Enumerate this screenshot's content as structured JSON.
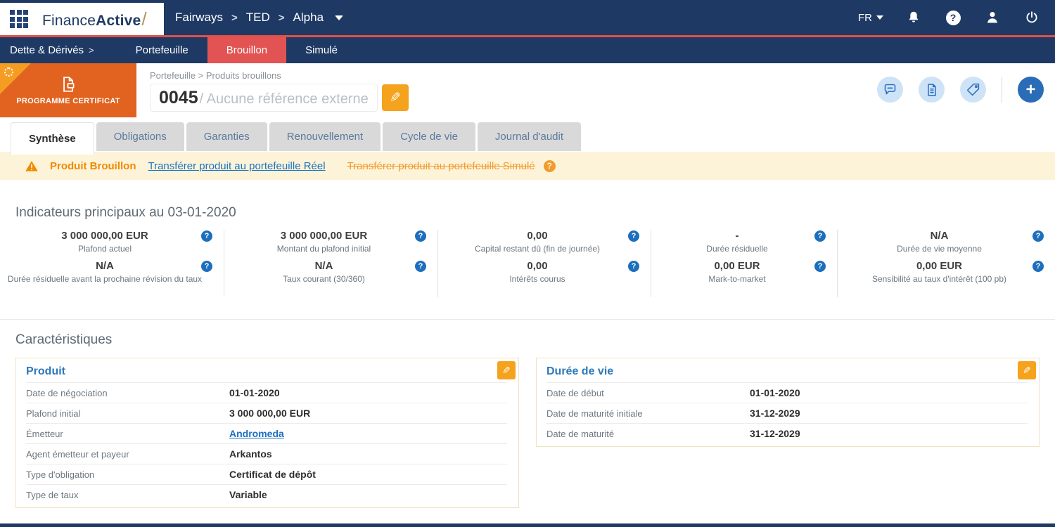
{
  "topbar": {
    "brand_regular": "Finance",
    "brand_bold": "Active",
    "breadcrumb": [
      "Fairways",
      "TED",
      "Alpha"
    ],
    "separator": ">",
    "lang": "FR"
  },
  "subnav": {
    "section": "Dette & Dérivés",
    "section_arrow": ">",
    "items": [
      "Portefeuille",
      "Brouillon",
      "Simulé"
    ]
  },
  "header": {
    "badge": "PROGRAMME CERTIFICAT",
    "breadcrumb": "Portefeuille > Produits brouillons",
    "product_id": "0045",
    "reference": "/ Aucune référence externe"
  },
  "tabs": [
    "Synthèse",
    "Obligations",
    "Garanties",
    "Renouvellement",
    "Cycle de vie",
    "Journal d'audit"
  ],
  "warning": {
    "label": "Produit Brouillon",
    "transfer_real": "Transférer produit au portefeuille Réel",
    "transfer_simulated": "Transférer produit au portefeuille Simulé"
  },
  "indicators": {
    "title": "Indicateurs principaux au 03-01-2020",
    "columns": [
      {
        "top_value": "3 000 000,00 EUR",
        "top_label": "Plafond actuel",
        "bottom_value": "N/A",
        "bottom_label": "Durée résiduelle avant la prochaine révision du taux"
      },
      {
        "top_value": "3 000 000,00 EUR",
        "top_label": "Montant du plafond initial",
        "bottom_value": "N/A",
        "bottom_label": "Taux courant (30/360)"
      },
      {
        "top_value": "0,00",
        "top_label": "Capital restant dû (fin de journée)",
        "bottom_value": "0,00",
        "bottom_label": "Intérêts courus"
      },
      {
        "top_value": "-",
        "top_label": "Durée résiduelle",
        "bottom_value": "0,00 EUR",
        "bottom_label": "Mark-to-market"
      },
      {
        "top_value": "N/A",
        "top_label": "Durée de vie moyenne",
        "bottom_value": "0,00 EUR",
        "bottom_label": "Sensibilité au taux d'intérêt (100 pb)"
      }
    ]
  },
  "characteristics": {
    "title": "Caractéristiques",
    "cards": [
      {
        "title": "Produit",
        "rows": [
          {
            "label": "Date de négociation",
            "value": "01-01-2020"
          },
          {
            "label": "Plafond initial",
            "value": "3 000 000,00 EUR"
          },
          {
            "label": "Émetteur",
            "value": "Andromeda"
          },
          {
            "label": "Agent émetteur et payeur",
            "value": "Arkantos"
          },
          {
            "label": "Type d'obligation",
            "value": "Certificat de dépôt"
          },
          {
            "label": "Type de taux",
            "value": "Variable"
          }
        ]
      },
      {
        "title": "Durée de vie",
        "rows": [
          {
            "label": "Date de début",
            "value": "01-01-2020"
          },
          {
            "label": "Date de maturité initiale",
            "value": "31-12-2029"
          },
          {
            "label": "Date de maturité",
            "value": "31-12-2029"
          }
        ]
      }
    ]
  },
  "colors": {
    "navy": "#1e3a64",
    "accent_red": "#e25048",
    "tab_red": "#e25453",
    "badge_orange": "#e2621f",
    "badge_corner": "#f59d23",
    "edit_orange": "#f5a21d",
    "warning_bg": "#fdf3d8",
    "warning_orange": "#f08a00",
    "link_blue": "#1a73c4",
    "help_blue": "#1d6fbd",
    "icon_circle_bg": "#cfe3f7",
    "icon_blue": "#2a6fc0"
  }
}
